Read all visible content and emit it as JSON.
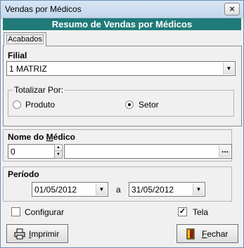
{
  "window": {
    "title": "Vendas por Médicos",
    "close_symbol": "×"
  },
  "banner": {
    "text": "Resumo de Vendas por Médicos"
  },
  "tabs": [
    {
      "label": "Acabados"
    }
  ],
  "filial": {
    "label": "Filial",
    "value": "1 MATRIZ"
  },
  "totalizar": {
    "legend": "Totalizar Por:",
    "options": [
      {
        "label": "Produto",
        "checked": false
      },
      {
        "label": "Setor",
        "checked": true
      }
    ]
  },
  "medico": {
    "label_prefix": "Nome do ",
    "label_underlined": "M",
    "label_suffix": "édico",
    "code": "0",
    "name": "",
    "lookup_symbol": "..."
  },
  "periodo": {
    "label": "Período",
    "from": "01/05/2012",
    "separator": "a",
    "to": "31/05/2012"
  },
  "options": {
    "configurar": {
      "label": "Configurar",
      "checked": false
    },
    "tela": {
      "label": "Tela",
      "checked": true
    }
  },
  "buttons": {
    "imprimir": {
      "underlined": "I",
      "rest": "mprimir"
    },
    "fechar": {
      "underlined": "F",
      "rest": "echar"
    }
  }
}
